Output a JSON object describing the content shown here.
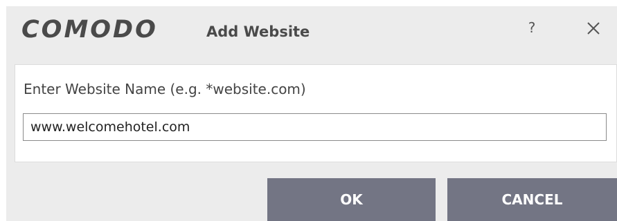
{
  "window": {
    "logo_text": "COMODO",
    "title": "Add Website",
    "help_label": "?",
    "close_icon": "close-icon"
  },
  "form": {
    "label": "Enter Website Name (e.g. *website.com)",
    "website_value": "www.welcomehotel.com"
  },
  "buttons": {
    "ok_label": "OK",
    "cancel_label": "CANCEL"
  },
  "colors": {
    "dialog_background": "#ececec",
    "panel_background": "#ffffff",
    "button_background": "#737584",
    "text_dark": "#4a4a4a"
  }
}
